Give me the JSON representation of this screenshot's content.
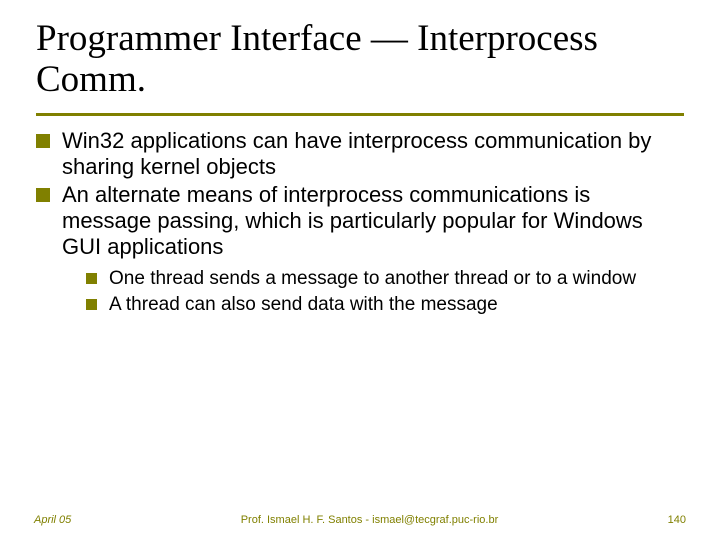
{
  "title": "Programmer Interface — Interprocess Comm.",
  "bullets": [
    {
      "text": "Win32 applications can have interprocess communication by sharing kernel objects"
    },
    {
      "text": "An alternate means of interprocess communications is message passing, which is particularly popular for Windows GUI applications",
      "sub": [
        "One thread sends a message to another thread or to a window",
        "A thread can also send data with the message"
      ]
    }
  ],
  "footer": {
    "date": "April 05",
    "center": "Prof. Ismael H. F. Santos - ismael@tecgraf.puc-rio.br",
    "page": "140"
  }
}
